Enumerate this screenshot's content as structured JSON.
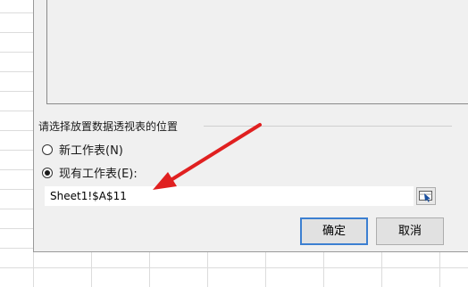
{
  "dialog": {
    "location_group_label": "请选择放置数据透视表的位置",
    "options": [
      {
        "label": "新工作表(N)",
        "checked": false
      },
      {
        "label": "现有工作表(E):",
        "checked": true
      }
    ],
    "location_value": "Sheet1!$A$11",
    "ok_label": "确定",
    "cancel_label": "取消"
  },
  "colors": {
    "dialog_bg": "#f0f0f0",
    "primary_button_border": "#3c7fd1",
    "annotation_arrow": "#e02020"
  },
  "icons": {
    "collapse": "range-select-icon",
    "annotation": "red-arrow-icon"
  }
}
